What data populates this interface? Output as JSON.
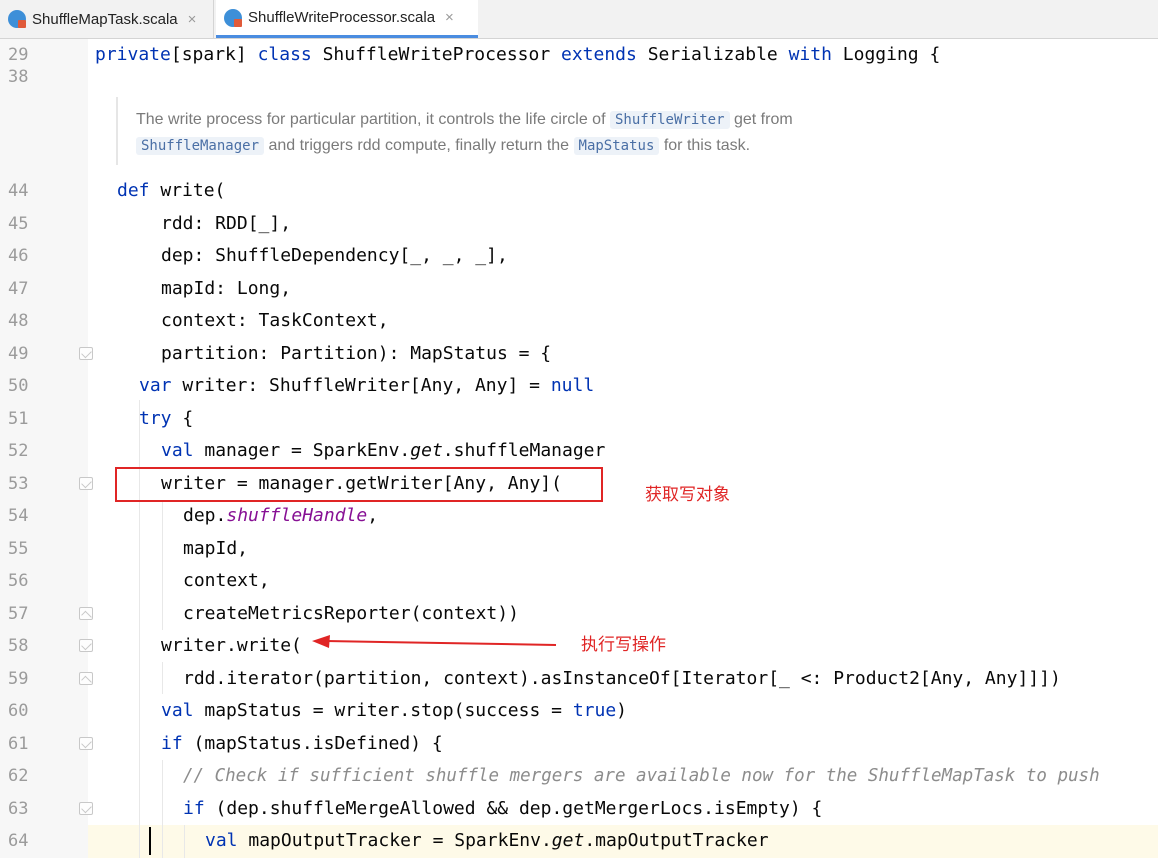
{
  "tabs": [
    {
      "label": "ShuffleMapTask.scala",
      "close": "×"
    },
    {
      "label": "ShuffleWriteProcessor.scala",
      "close": "×"
    }
  ],
  "line_numbers": [
    "29",
    "38",
    "44",
    "45",
    "46",
    "47",
    "48",
    "49",
    "50",
    "51",
    "52",
    "53",
    "54",
    "55",
    "56",
    "57",
    "58",
    "59",
    "60",
    "61",
    "62",
    "63",
    "64"
  ],
  "code": {
    "l29": {
      "kw1": "private",
      "t1": "[spark] ",
      "kw2": "class",
      "t2": " ShuffleWriteProcessor ",
      "kw3": "extends",
      "t3": " Serializable ",
      "kw4": "with",
      "t4": " Logging {"
    },
    "l44": {
      "kw": "def",
      "t": " write("
    },
    "l45": "rdd: RDD[_],",
    "l46": "dep: ShuffleDependency[_, _, _],",
    "l47": "mapId: Long,",
    "l48": "context: TaskContext,",
    "l49": "partition: Partition): MapStatus = {",
    "l50": {
      "kw": "var",
      "t": " writer: ShuffleWriter[Any, Any] = ",
      "kw2": "null"
    },
    "l51": {
      "kw": "try",
      "t": " {"
    },
    "l52": {
      "kw": "val",
      "t": " manager = SparkEnv.",
      "it": "get",
      "t2": ".shuffleManager"
    },
    "l53": "writer = manager.getWriter[Any, Any](",
    "l54": {
      "t": "dep.",
      "purple": "shuffleHandle",
      "t2": ","
    },
    "l55": "mapId,",
    "l56": "context,",
    "l57": "createMetricsReporter(context))",
    "l58": "writer.write(",
    "l59": "rdd.iterator(partition, context).asInstanceOf[Iterator[_ <: Product2[Any, Any]]])",
    "l60": {
      "kw": "val",
      "t": " mapStatus = writer.stop(success = ",
      "kw2": "true",
      "t2": ")"
    },
    "l61": {
      "kw": "if",
      "t": " (mapStatus.isDefined) {"
    },
    "l62": "// Check if sufficient shuffle mergers are available now for the ShuffleMapTask to push",
    "l63": {
      "kw": "if",
      "t": " (dep.shuffleMergeAllowed && dep.getMergerLocs.isEmpty) {"
    },
    "l64": {
      "kw": "val",
      "t": " mapOutputTracker = SparkEnv.",
      "it": "get",
      "t2": ".mapOutputTracker"
    }
  },
  "doc": {
    "line1_a": "The write process for particular partition, it controls the life circle of ",
    "code1": "ShuffleWriter",
    "line1_b": " get from",
    "code2": "ShuffleManager",
    "line2_a": " and triggers rdd compute, finally return the ",
    "code3": "MapStatus",
    "line2_b": " for this task."
  },
  "annotations": {
    "get_writer": "获取写对象",
    "do_write": "执行写操作"
  },
  "colors": {
    "keyword": "#0033b3",
    "annotation_red": "#e02525",
    "comment": "#8c8c8c",
    "purple_field": "#871094"
  }
}
